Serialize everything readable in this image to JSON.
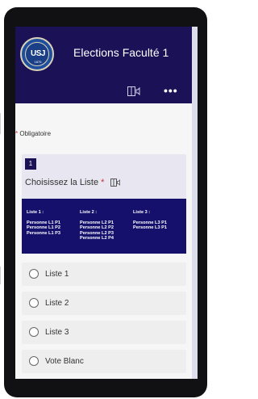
{
  "header": {
    "logo_text": "USJ",
    "logo_year": "1875",
    "title": "Elections Faculté 1",
    "icons": [
      "immersive-reader-icon",
      "more-icon"
    ],
    "more_glyph": "•••"
  },
  "form": {
    "required_star": "*",
    "required_text": "Obligatoire",
    "question": {
      "number": "1",
      "title": "Choisissez la Liste",
      "required_star": "*",
      "lists": [
        {
          "head": "Liste 1 :",
          "people": [
            "Personne L1 P1",
            "Personne L1 P2",
            "Personne L1 P3"
          ]
        },
        {
          "head": "Liste 2 :",
          "people": [
            "Personne L2 P1",
            "Personne L2 P2",
            "Personne L2 P3",
            "Personne L2 P4"
          ]
        },
        {
          "head": "Liste 3 :",
          "people": [
            "Personne L3 P1",
            "Personne L3 P1"
          ]
        }
      ],
      "options": [
        "Liste 1",
        "Liste 2",
        "Liste 3",
        "Vote Blanc"
      ]
    }
  },
  "colors": {
    "header_bg": "#1a1157",
    "required_star": "#c43131",
    "list_image_bg": "#14106c"
  }
}
